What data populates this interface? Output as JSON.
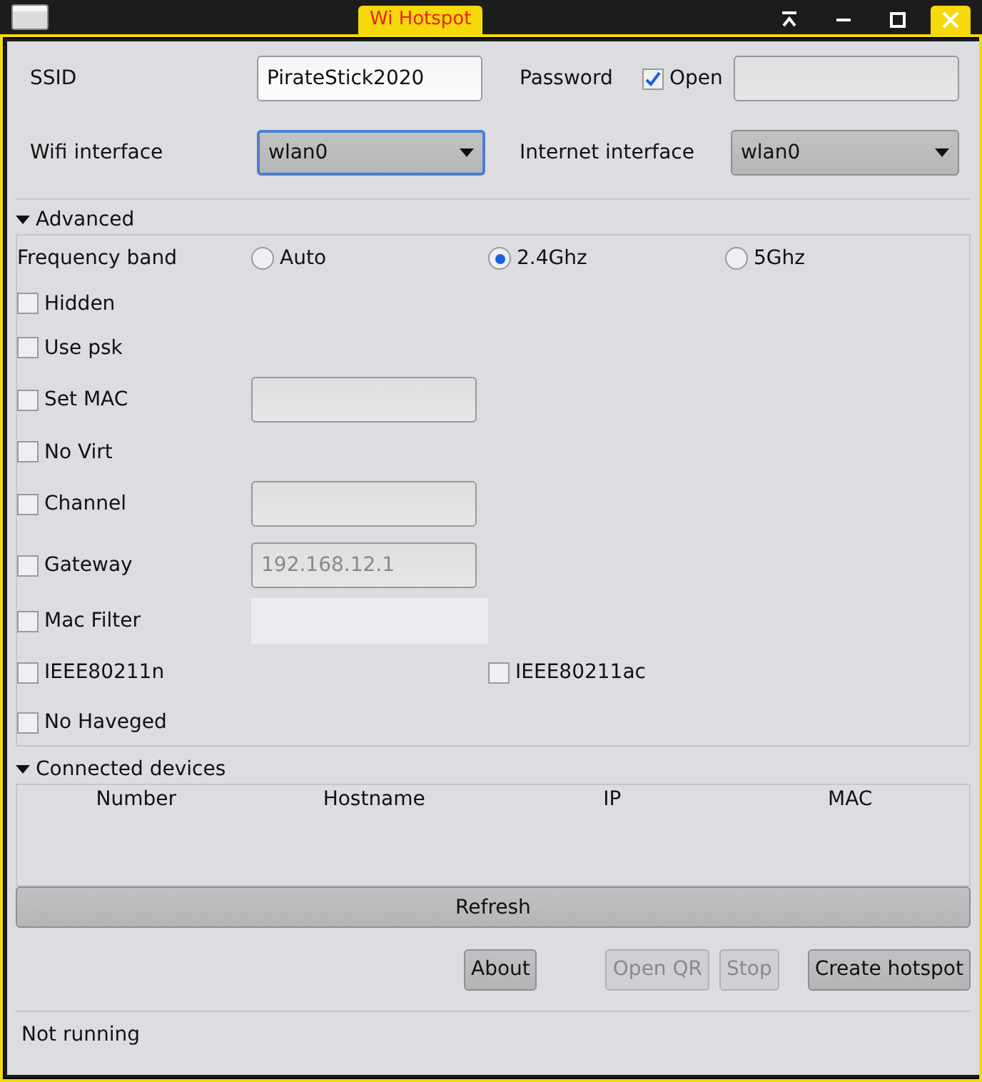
{
  "window": {
    "title": "Wi Hotspot"
  },
  "ssid": {
    "label": "SSID",
    "value": "PirateStick2020"
  },
  "password": {
    "label": "Password",
    "open": {
      "label": "Open",
      "checked": true
    }
  },
  "wifi_interface": {
    "label": "Wifi interface",
    "value": "wlan0",
    "focused": true
  },
  "internet_interface": {
    "label": "Internet interface",
    "value": "wlan0",
    "focused": false
  },
  "advanced": {
    "label": "Advanced",
    "expanded": true,
    "frequency_band": {
      "label": "Frequency band",
      "options": [
        {
          "label": "Auto",
          "selected": false
        },
        {
          "label": "2.4Ghz",
          "selected": true
        },
        {
          "label": "5Ghz",
          "selected": false
        }
      ]
    },
    "options": [
      {
        "kind": "check",
        "label": "Hidden",
        "checked": false
      },
      {
        "kind": "check",
        "label": "Use psk",
        "checked": false
      },
      {
        "kind": "field",
        "label": "Set MAC",
        "checked": false
      },
      {
        "kind": "check",
        "label": "No Virt",
        "checked": false
      },
      {
        "kind": "field",
        "label": "Channel",
        "checked": false
      },
      {
        "kind": "field",
        "label": "Gateway",
        "checked": false,
        "placeholder": "192.168.12.1"
      },
      {
        "kind": "area",
        "label": "Mac Filter",
        "checked": false
      },
      {
        "kind": "pair",
        "items": [
          {
            "label": "IEEE80211n",
            "checked": false
          },
          {
            "label": "IEEE80211ac",
            "checked": false
          }
        ]
      },
      {
        "kind": "check",
        "label": "No Haveged",
        "checked": false
      }
    ]
  },
  "connected_devices": {
    "label": "Connected devices",
    "expanded": true,
    "columns": [
      "Number",
      "Hostname",
      "IP",
      "MAC"
    ]
  },
  "refresh": "Refresh",
  "buttons": [
    {
      "label": "About",
      "disabled": false
    },
    {
      "label": "Open QR",
      "disabled": true
    },
    {
      "label": "Stop",
      "disabled": true
    },
    {
      "label": "Create hotspot",
      "disabled": false
    }
  ],
  "status": "Not running"
}
